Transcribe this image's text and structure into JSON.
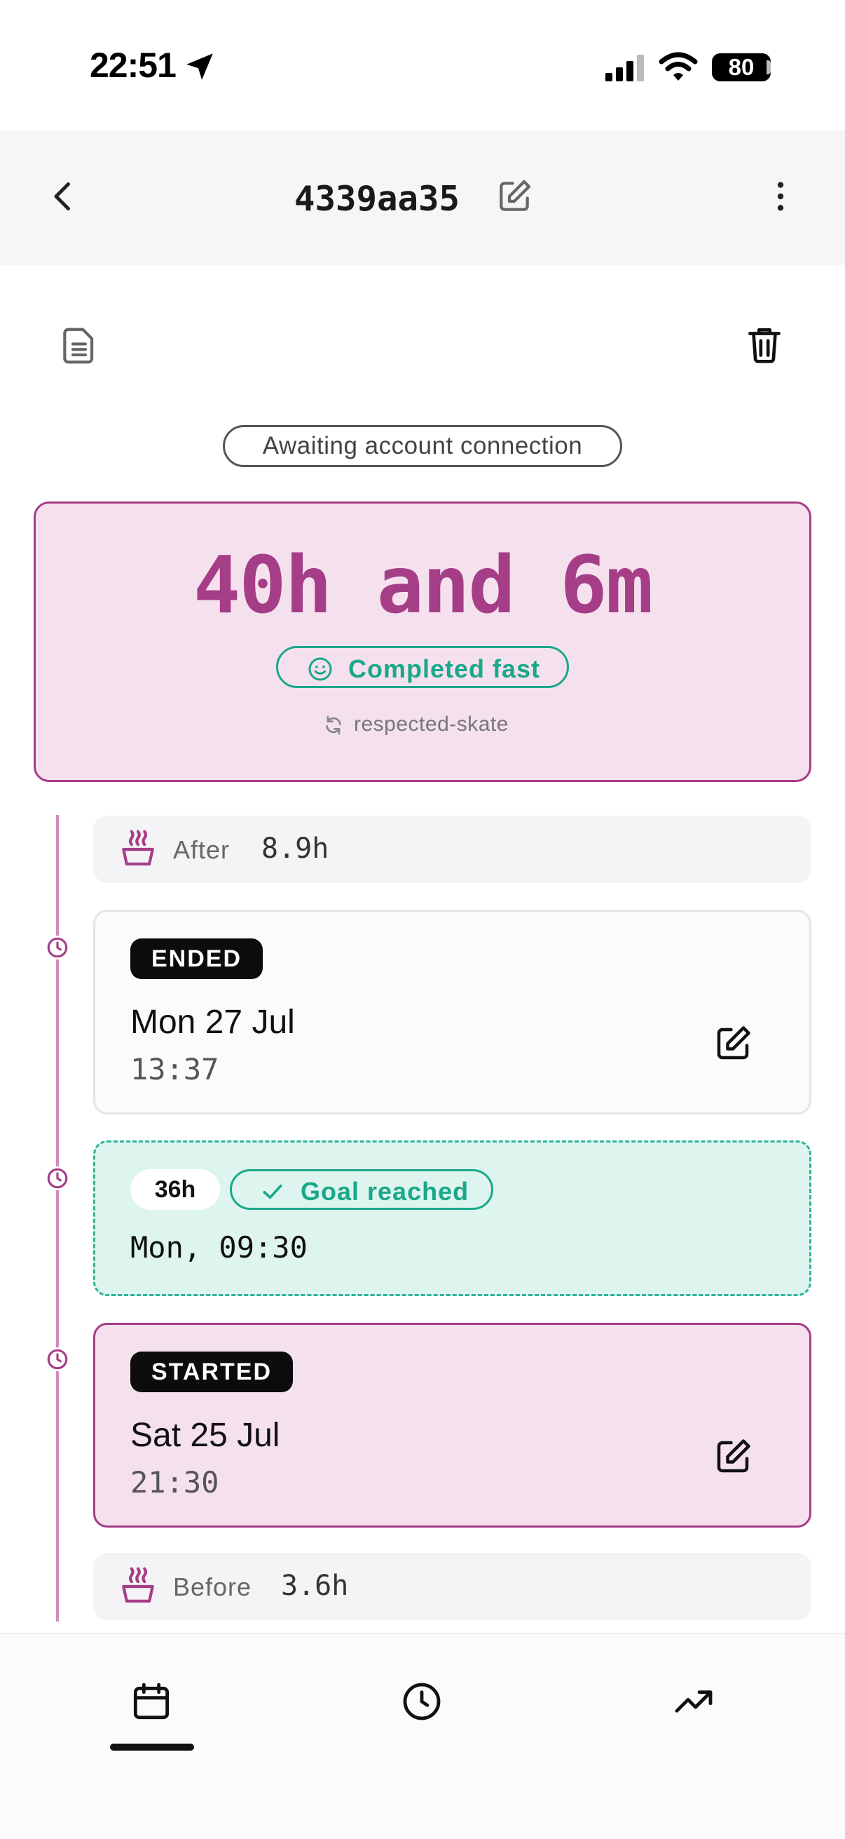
{
  "status_bar": {
    "time": "22:51",
    "battery": "80"
  },
  "header": {
    "title": "4339aa35"
  },
  "status_pill": {
    "label": "Awaiting account connection"
  },
  "summary": {
    "duration": "40h and 6m",
    "completed_label": "Completed fast",
    "sync_label": "respected-skate"
  },
  "timeline": {
    "after": {
      "label": "After",
      "value": "8.9h"
    },
    "ended": {
      "tag": "ENDED",
      "date": "Mon 27 Jul",
      "time": "13:37"
    },
    "goal": {
      "hours": "36h",
      "label": "Goal reached",
      "time": "Mon, 09:30"
    },
    "started": {
      "tag": "STARTED",
      "date": "Sat 25 Jul",
      "time": "21:30"
    },
    "before": {
      "label": "Before",
      "value": "3.6h"
    }
  },
  "colors": {
    "accent": "#a53d87",
    "accent_bg": "#f5e1ee",
    "success": "#1aa88a",
    "success_bg": "#def5ef"
  },
  "icons": {
    "back": "chevron-left-icon",
    "edit_title": "pencil-square-icon",
    "more": "dots-vertical-icon",
    "notes": "document-icon",
    "delete": "trash-icon",
    "smiley": "smiley-icon",
    "sync": "sync-icon",
    "meal": "steaming-bowl-icon",
    "clock": "clock-icon",
    "check": "check-icon",
    "nav_calendar": "calendar-icon",
    "nav_timer": "clock-icon",
    "nav_trends": "trending-up-icon"
  }
}
